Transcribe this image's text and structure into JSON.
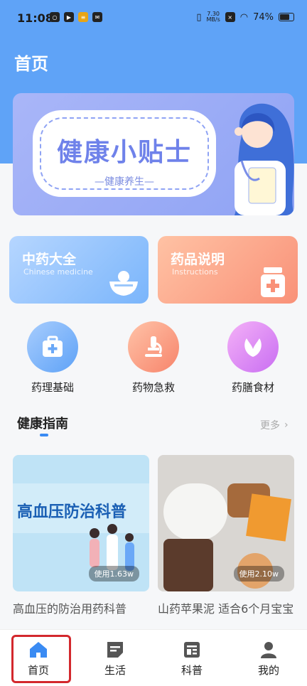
{
  "status_bar": {
    "time": "11:08",
    "net_speed_value": "7.30",
    "net_speed_unit": "MB/s",
    "battery": "74%"
  },
  "header": {
    "title": "首页"
  },
  "banner": {
    "title": "健康小贴士",
    "subtitle": "—健康养生—"
  },
  "cards": [
    {
      "title": "中药大全",
      "subtitle": "Chinese medicine"
    },
    {
      "title": "药品说明",
      "subtitle": "Instructions"
    }
  ],
  "categories": [
    {
      "label": "药理基础"
    },
    {
      "label": "药物急救"
    },
    {
      "label": "药膳食材"
    }
  ],
  "guide": {
    "title": "健康指南",
    "more": "更多"
  },
  "articles": [
    {
      "title": "高血压的防治用药科普",
      "views": "使用1.63w",
      "thumb_text": "高血压防治科普"
    },
    {
      "title": "山药苹果泥 适合6个月宝宝",
      "views": "使用2.10w"
    }
  ],
  "tabs": [
    {
      "label": "首页"
    },
    {
      "label": "生活"
    },
    {
      "label": "科普"
    },
    {
      "label": "我的"
    }
  ],
  "colors": {
    "primary": "#5fa3f7",
    "active_tab": "#3a8bf3",
    "highlight": "#d3282d"
  }
}
